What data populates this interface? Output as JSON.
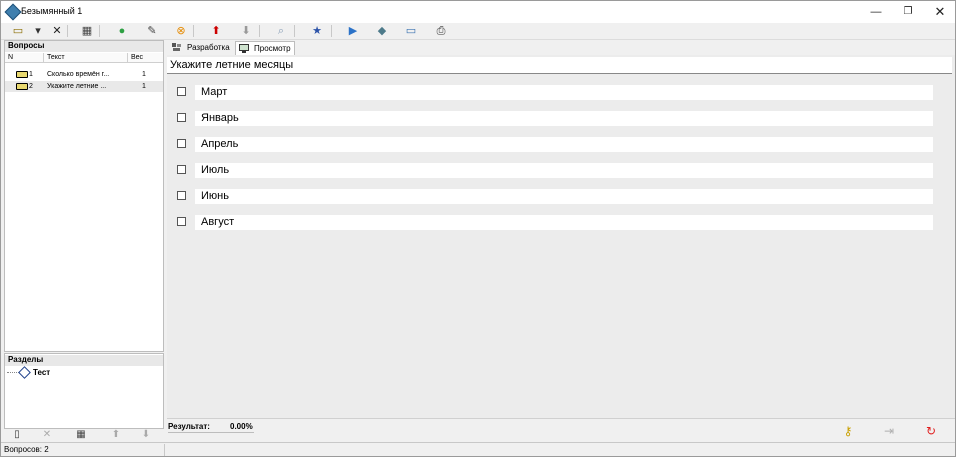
{
  "window": {
    "title": "Безымянный 1",
    "controls": {
      "minimize": "—",
      "maximize": "❐",
      "close": "✕"
    }
  },
  "toolbar": {
    "items": [
      {
        "name": "new-question-icon",
        "glyph": "▭",
        "color": "#8a6d00"
      },
      {
        "name": "dropdown-arrow-icon",
        "glyph": "▾",
        "color": "#333333"
      },
      {
        "name": "delete-icon",
        "glyph": "✕",
        "color": "#222222"
      },
      {
        "name": "properties-icon",
        "glyph": "▦",
        "color": "#444444"
      },
      {
        "name": "add-answer-icon",
        "glyph": "●",
        "color": "#2ea043"
      },
      {
        "name": "edit-icon",
        "glyph": "✎",
        "color": "#444444"
      },
      {
        "name": "remove-answer-icon",
        "glyph": "⊗",
        "color": "#e58a00"
      },
      {
        "name": "move-up-icon",
        "glyph": "⬆",
        "color": "#cc0000"
      },
      {
        "name": "move-down-icon",
        "glyph": "⬇",
        "color": "#9a9a9a"
      },
      {
        "name": "search-icon",
        "glyph": "⌕",
        "color": "#8aa0b8"
      },
      {
        "name": "star-icon",
        "glyph": "★",
        "color": "#2b52a8"
      },
      {
        "name": "play-icon",
        "glyph": "▶",
        "color": "#2b72c8"
      },
      {
        "name": "export-icon",
        "glyph": "◆",
        "color": "#4d7a8a"
      },
      {
        "name": "window-icon",
        "glyph": "▭",
        "color": "#3a72b0"
      },
      {
        "name": "print-icon",
        "glyph": "⎙",
        "color": "#333333"
      }
    ]
  },
  "questions_panel": {
    "title": "Вопросы",
    "columns": [
      "N",
      "Текст",
      "Вес"
    ],
    "rows": [
      {
        "n": "1",
        "text": "Сколько времён г...",
        "weight": "1"
      },
      {
        "n": "2",
        "text": "Укажите летние ...",
        "weight": "1"
      }
    ]
  },
  "sections_panel": {
    "title": "Разделы",
    "items": [
      {
        "label": "Тест"
      }
    ]
  },
  "left_toolbar": {
    "items": [
      {
        "name": "new-doc-icon",
        "glyph": "▯",
        "color": "#333333"
      },
      {
        "name": "delete-section-icon",
        "glyph": "✕",
        "color": "#aaaaaa"
      },
      {
        "name": "section-properties-icon",
        "glyph": "▦",
        "color": "#444444"
      },
      {
        "name": "section-up-icon",
        "glyph": "⬆",
        "color": "#aaaaaa"
      },
      {
        "name": "section-down-icon",
        "glyph": "⬇",
        "color": "#aaaaaa"
      }
    ]
  },
  "tabs": [
    {
      "label": "Разработка",
      "active": false
    },
    {
      "label": "Просмотр",
      "active": true
    }
  ],
  "preview": {
    "question": "Укажите летние месяцы",
    "options": [
      "Март",
      "Январь",
      "Апрель",
      "Июль",
      "Июнь",
      "Август"
    ]
  },
  "result": {
    "label": "Результат:",
    "value": "0.00%",
    "buttons": [
      {
        "name": "key-icon",
        "glyph": "⚷",
        "color": "#c9a000"
      },
      {
        "name": "next-icon",
        "glyph": "⇥",
        "color": "#b0b0b0"
      },
      {
        "name": "restart-icon",
        "glyph": "↻",
        "color": "#e02020"
      }
    ]
  },
  "status": {
    "text": "Вопросов: 2"
  }
}
